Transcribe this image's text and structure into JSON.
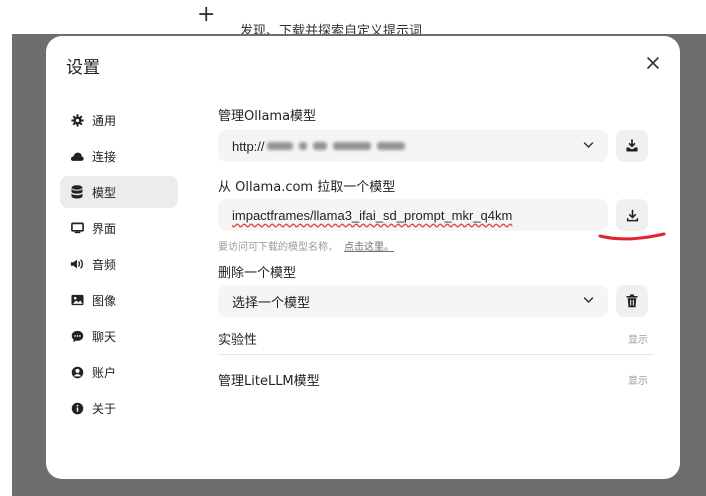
{
  "background": {
    "hint_text": "发现、下载并探索自定义提示词",
    "plus_glyph": "+"
  },
  "modal": {
    "title": "设置",
    "close_icon": "close-icon"
  },
  "sidebar": {
    "items": [
      {
        "label": "通用",
        "icon": "gear-icon",
        "active": false
      },
      {
        "label": "连接",
        "icon": "cloud-icon",
        "active": false
      },
      {
        "label": "模型",
        "icon": "database-icon",
        "active": true
      },
      {
        "label": "界面",
        "icon": "monitor-icon",
        "active": false
      },
      {
        "label": "音频",
        "icon": "speaker-icon",
        "active": false
      },
      {
        "label": "图像",
        "icon": "image-icon",
        "active": false
      },
      {
        "label": "聊天",
        "icon": "chat-bubble-icon",
        "active": false
      },
      {
        "label": "账户",
        "icon": "user-icon",
        "active": false
      },
      {
        "label": "关于",
        "icon": "info-icon",
        "active": false
      }
    ]
  },
  "models": {
    "manage_title": "管理Ollama模型",
    "server_url_prefix": "http://",
    "pull_title": "从 Ollama.com 拉取一个模型",
    "pull_input_value": "impactframes/llama3_ifai_sd_prompt_mkr_q4km",
    "hint_text": "要访问可下载的模型名称，",
    "hint_link": "点击这里。",
    "delete_title": "删除一个模型",
    "delete_select_value": "选择一个模型",
    "experimental_label": "实验性",
    "experimental_toggle": "显示",
    "litellm_label": "管理LiteLLM模型",
    "litellm_toggle": "显示"
  },
  "colors": {
    "overlay": "#6e6e6e",
    "modal_bg": "#ffffff",
    "field_bg": "#f5f5f5",
    "active_item_bg": "#ececec",
    "annotation_red": "#e0242c"
  }
}
